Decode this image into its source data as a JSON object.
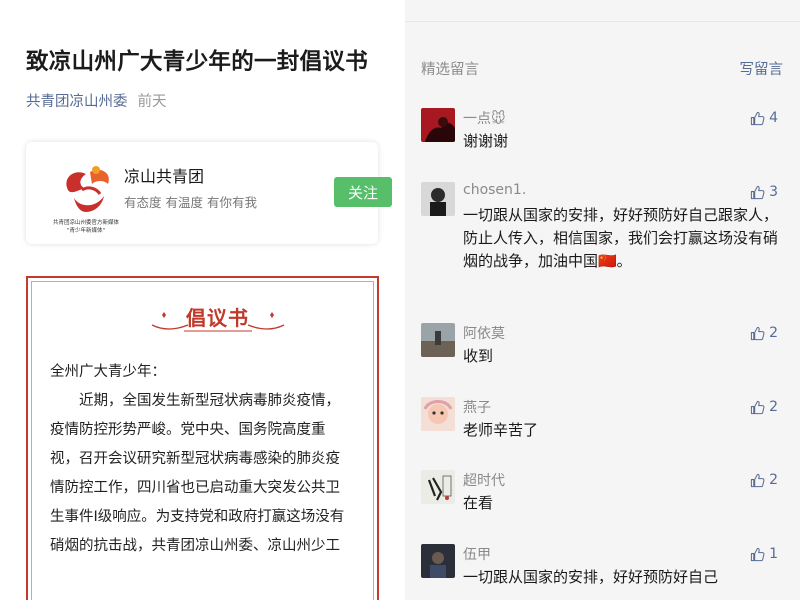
{
  "article": {
    "title": "致凉山州广大青少年的一封倡议书",
    "author": "共青团凉山州委",
    "date": "前天",
    "account_card": {
      "logo_text": "共青团凉山州委官方新媒体 \"青少年新媒体\"",
      "name": "凉山共青团",
      "description": "有态度 有温度 有你有我",
      "follow_label": "关注"
    },
    "letter": {
      "heading": "倡议书",
      "lines": [
        "全州广大青少年：",
        "　　近期，全国发生新型冠状病毒肺炎疫情，",
        "疫情防控形势严峻。党中央、国务院高度重",
        "视，召开会议研究新型冠状病毒感染的肺炎疫",
        "情防控工作，四川省也已启动重大突发公共卫",
        "生事件I级响应。为支持党和政府打赢这场没有",
        "硝烟的抗击战，共青团凉山州委、凉山州少工"
      ]
    }
  },
  "comments_section": {
    "header": "精选留言",
    "write_label": "写留言",
    "comments": [
      {
        "name": "一点🐭",
        "text": "谢谢谢",
        "likes": "4",
        "avatar": "red-portrait-avatar"
      },
      {
        "name": "chosen1.",
        "text": "一切跟从国家的安排，好好预防好自己跟家人，防止人传入，相信国家，我们会打赢这场没有硝烟的战争，加油中国🇨🇳。",
        "likes": "3",
        "avatar": "man-portrait-avatar"
      },
      {
        "name": "阿依莫",
        "text": "收到",
        "likes": "2",
        "avatar": "outdoor-photo-avatar"
      },
      {
        "name": "燕子",
        "text": "老师辛苦了",
        "likes": "2",
        "avatar": "child-photo-avatar"
      },
      {
        "name": "超时代",
        "text": "在看",
        "likes": "2",
        "avatar": "calligraphy-avatar"
      },
      {
        "name": "伍甲",
        "text": "一切跟从国家的安排，好好预防好自己",
        "likes": "1",
        "avatar": "dark-photo-avatar"
      }
    ]
  },
  "colors": {
    "link_blue": "#576b95",
    "follow_green": "#57be6a",
    "letter_red": "#c23b2c"
  }
}
